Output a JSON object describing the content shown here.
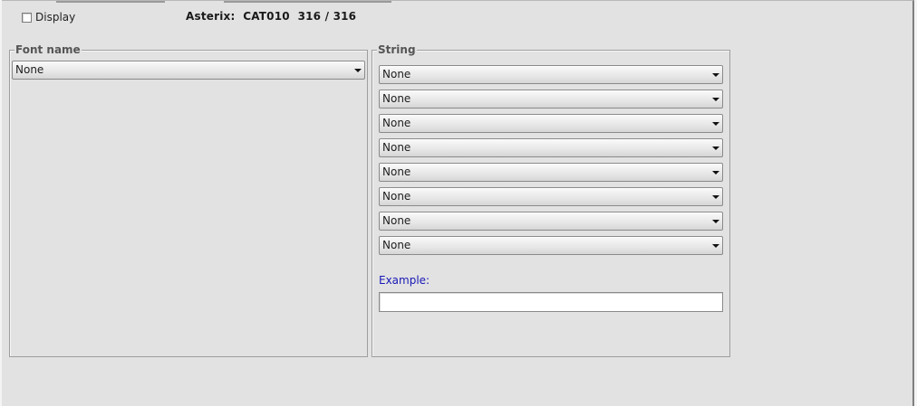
{
  "display": {
    "checkbox_checked": false,
    "label": "Display"
  },
  "info": {
    "text": "Asterix:  CAT010  316 / 316"
  },
  "font_group": {
    "legend": "Font name",
    "combo": {
      "value": "None"
    }
  },
  "string_group": {
    "legend": "String",
    "combos": [
      {
        "value": "None"
      },
      {
        "value": "None"
      },
      {
        "value": "None"
      },
      {
        "value": "None"
      },
      {
        "value": "None"
      },
      {
        "value": "None"
      },
      {
        "value": "None"
      },
      {
        "value": "None"
      }
    ],
    "example_label": "Example:",
    "example_value": ""
  },
  "colors": {
    "panel_background": "#e2e2e2",
    "example_label": "#1818b8",
    "border": "#9e9e9e"
  }
}
